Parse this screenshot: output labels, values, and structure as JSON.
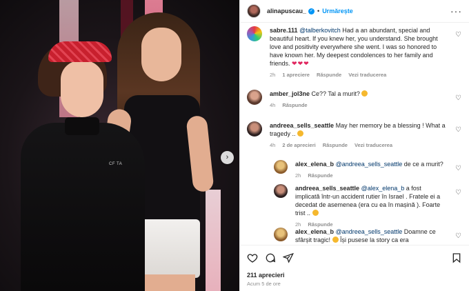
{
  "header": {
    "username": "alinapuscau_",
    "separator": "•",
    "follow_label": "Urmărește",
    "more_label": "···"
  },
  "media": {
    "jacket_text": "CF TA"
  },
  "comments": [
    {
      "username": "sabre.111",
      "mention": "@talberkovitch",
      "text": "Had a an abundant, special and beautiful heart. If you knew her, you understand. She brought love and positivity everywhere she went. I was so honored to have known her. My deepest condolences to her family and friends.",
      "emoji": "❤❤❤",
      "time": "2h",
      "likes": "1 apreciere",
      "reply_label": "Răspunde",
      "translate_label": "Vezi traducerea"
    },
    {
      "username": "amber_jol3ne",
      "text": "Ce?? Tal a murit?",
      "time": "4h",
      "reply_label": "Răspunde"
    },
    {
      "username": "andreea_sells_seattle",
      "text": "May her memory be a blessing ! What a tragedy ..",
      "time": "4h",
      "likes": "2 de aprecieri",
      "reply_label": "Răspunde",
      "translate_label": "Vezi traducerea"
    },
    {
      "username": "alex_elena_b",
      "mention": "@andreea_sells_seattle",
      "text": "de ce a murit?",
      "time": "2h",
      "reply_label": "Răspunde"
    },
    {
      "username": "andreea_sells_seattle",
      "mention": "@alex_elena_b",
      "text": "a fost implicată într-un accident rutier în Israel . Fratele ei a decedat de asemenea (era cu ea în mașină ). Foarte trist ..",
      "time": "2h",
      "reply_label": "Răspunde"
    },
    {
      "username": "alex_elena_b",
      "mention": "@andreea_sells_seattle",
      "text": "Doamne ce sfârșit tragic!",
      "text2": "Își pusese la story ca era"
    }
  ],
  "footer": {
    "likes": "211 aprecieri",
    "time": "Acum 5 de ore"
  }
}
